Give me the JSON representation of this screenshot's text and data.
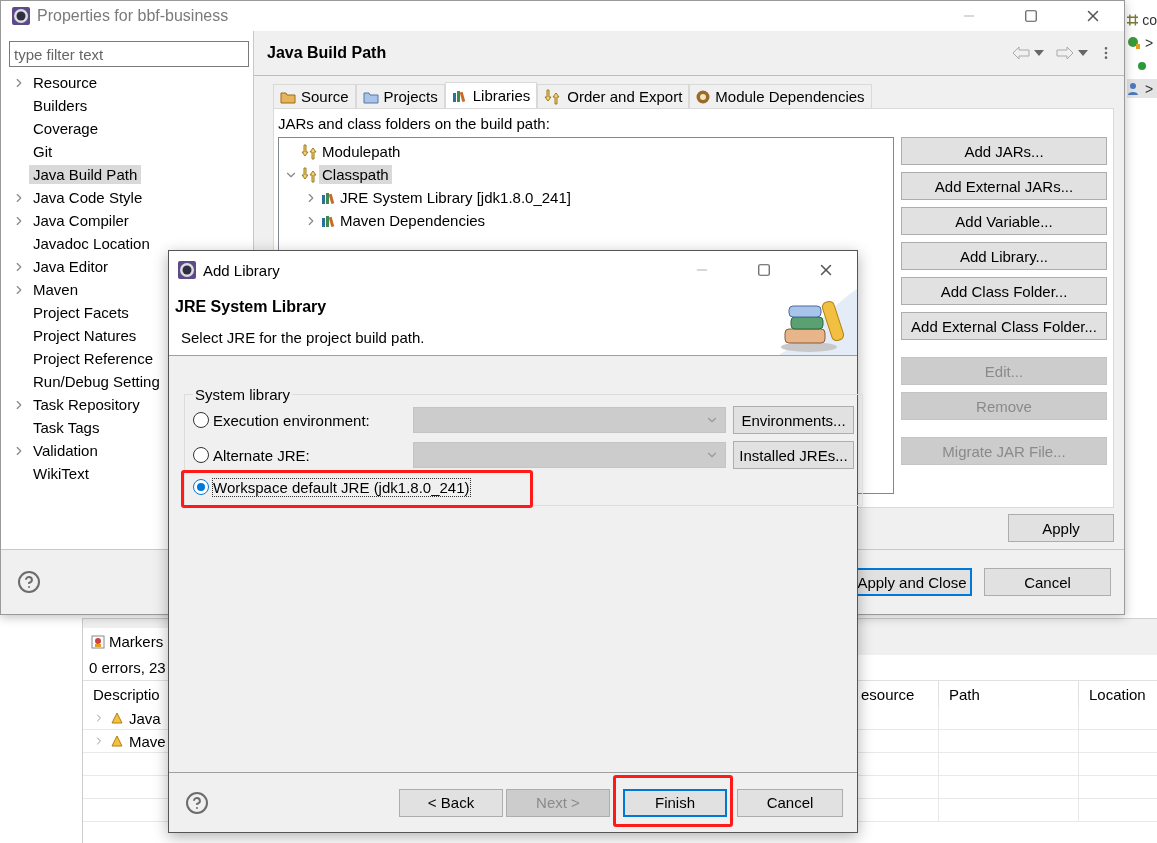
{
  "outline": {
    "items": [
      {
        "text": "co",
        "kind": "grid"
      },
      {
        "text": ">",
        "kind": "class"
      },
      {
        "kind": "dot"
      },
      {
        "text": ">",
        "kind": "person"
      }
    ]
  },
  "properties_window": {
    "title": "Properties for bbf-business",
    "filter": {
      "placeholder": "type filter text"
    },
    "sidebar": {
      "items": [
        {
          "label": "Resource",
          "expandable": true,
          "selected": false
        },
        {
          "label": "Builders",
          "expandable": false,
          "selected": false
        },
        {
          "label": "Coverage",
          "expandable": false,
          "selected": false
        },
        {
          "label": "Git",
          "expandable": false,
          "selected": false
        },
        {
          "label": "Java Build Path",
          "expandable": false,
          "selected": true
        },
        {
          "label": "Java Code Style",
          "expandable": true,
          "selected": false
        },
        {
          "label": "Java Compiler",
          "expandable": true,
          "selected": false
        },
        {
          "label": "Javadoc Location",
          "expandable": false,
          "selected": false
        },
        {
          "label": "Java Editor",
          "expandable": true,
          "selected": false
        },
        {
          "label": "Maven",
          "expandable": true,
          "selected": false
        },
        {
          "label": "Project Facets",
          "expandable": false,
          "selected": false
        },
        {
          "label": "Project Natures",
          "expandable": false,
          "selected": false
        },
        {
          "label": "Project Reference",
          "expandable": false,
          "selected": false
        },
        {
          "label": "Run/Debug Setting",
          "expandable": false,
          "selected": false
        },
        {
          "label": "Task Repository",
          "expandable": true,
          "selected": false
        },
        {
          "label": "Task Tags",
          "expandable": false,
          "selected": false
        },
        {
          "label": "Validation",
          "expandable": true,
          "selected": false
        },
        {
          "label": "WikiText",
          "expandable": false,
          "selected": false
        }
      ]
    },
    "page_title": "Java Build Path",
    "tabs": [
      {
        "label": "Source",
        "kind": "source",
        "selected": false
      },
      {
        "label": "Projects",
        "kind": "projects",
        "selected": false
      },
      {
        "label": "Libraries",
        "kind": "libraries",
        "selected": true
      },
      {
        "label": "Order and Export",
        "kind": "order",
        "selected": false
      },
      {
        "label": "Module Dependencies",
        "kind": "module",
        "selected": false
      }
    ],
    "libraries_label": "JARs and class folders on the build path:",
    "tree": [
      {
        "label": "Modulepath",
        "kind": "path",
        "expandable": false,
        "selected": false
      },
      {
        "label": "Classpath",
        "kind": "path",
        "expandable": true,
        "expanded": true,
        "selected": true,
        "children": [
          {
            "label": "JRE System Library [jdk1.8.0_241]",
            "kind": "library",
            "expandable": true,
            "expanded": false,
            "selected": false
          },
          {
            "label": "Maven Dependencies",
            "kind": "library",
            "expandable": true,
            "expanded": false,
            "selected": false
          }
        ]
      }
    ],
    "button_groups": [
      [
        {
          "label": "Add JARs...",
          "disabled": false
        },
        {
          "label": "Add External JARs...",
          "disabled": false
        },
        {
          "label": "Add Variable...",
          "disabled": false
        },
        {
          "label": "Add Library...",
          "disabled": false
        },
        {
          "label": "Add Class Folder...",
          "disabled": false
        },
        {
          "label": "Add External Class Folder...",
          "disabled": false
        }
      ],
      [
        {
          "label": "Edit...",
          "disabled": true
        },
        {
          "label": "Remove",
          "disabled": true
        }
      ],
      [
        {
          "label": "Migrate JAR File...",
          "disabled": true
        }
      ]
    ],
    "apply": "Apply",
    "footer_buttons": [
      {
        "label": "Apply and Close",
        "default": true
      },
      {
        "label": "Cancel",
        "default": false
      }
    ]
  },
  "markers": {
    "tab": "Markers",
    "summary": "0 errors, 23",
    "columns": [
      "Descriptio",
      "esource",
      "Path",
      "Location"
    ],
    "rows": [
      {
        "label": "Java",
        "kind": "warning"
      },
      {
        "label": "Mave",
        "kind": "warning"
      }
    ]
  },
  "dialog": {
    "title": "Add Library",
    "heading": "JRE System Library",
    "description": "Select JRE for the project build path.",
    "group_label": "System library",
    "options": [
      {
        "label": "Execution environment:",
        "selected": false,
        "highlighted": false,
        "button": "Environments..."
      },
      {
        "label": "Alternate JRE:",
        "selected": false,
        "highlighted": false,
        "button": "Installed JREs..."
      },
      {
        "label": "Workspace default JRE (jdk1.8.0_241)",
        "selected": true,
        "highlighted": true
      }
    ],
    "buttons": [
      {
        "label": "< Back",
        "disabled": false,
        "default": false,
        "highlighted": false
      },
      {
        "label": "Next >",
        "disabled": true,
        "default": false,
        "highlighted": false
      },
      {
        "label": "Finish",
        "disabled": false,
        "default": true,
        "highlighted": true
      },
      {
        "label": "Cancel",
        "disabled": false,
        "default": false,
        "highlighted": false
      }
    ]
  }
}
